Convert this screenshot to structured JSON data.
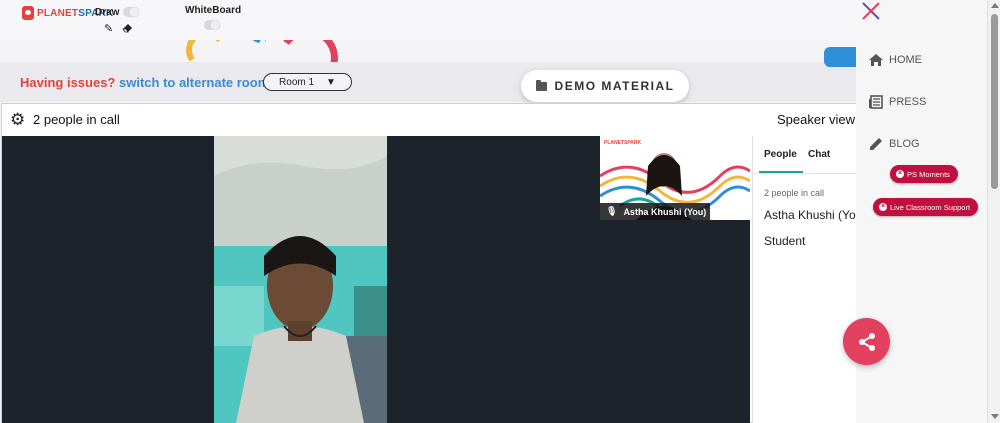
{
  "header": {
    "logo": {
      "part1": "PLANET",
      "part2": "SPARK"
    },
    "draw_label": "Draw",
    "whiteboard_label": "WhiteBoard"
  },
  "issues": {
    "prefix": "Having issues?",
    "link": "switch to alternate room",
    "room_selected": "Room 1"
  },
  "demo_material": {
    "label": "DEMO MATERIAL"
  },
  "call": {
    "people_count": "2 people in call",
    "view_mode": "Speaker view",
    "self_tile": {
      "logo": "PLANETSPARK",
      "name": "Astha Khushi (You)"
    },
    "panel": {
      "tabs": [
        "People",
        "Chat"
      ],
      "active_tab": "People",
      "count": "2 people in call",
      "participant_name": "Astha Khushi (Yo",
      "participant_role": "Student"
    }
  },
  "nav": {
    "items": [
      {
        "label": "HOME",
        "icon": "home-icon"
      },
      {
        "label": "PRESS",
        "icon": "press-icon"
      },
      {
        "label": "BLOG",
        "icon": "blog-icon"
      }
    ],
    "ps_moments": "PS Moments",
    "live_support": "Live Classroom Support"
  },
  "colors": {
    "brand_red": "#e2433d",
    "brand_blue": "#1d6bb3",
    "link_blue": "#3d8ad1",
    "pill_red": "#c0113e",
    "fab_pink": "#e2405c",
    "tab_teal": "#1aa39a"
  }
}
